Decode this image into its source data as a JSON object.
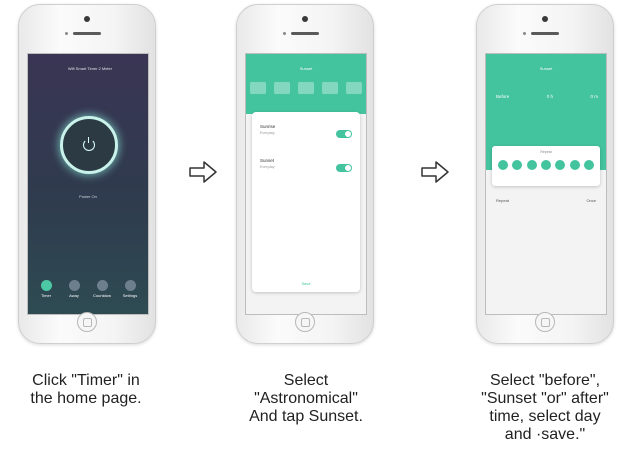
{
  "steps": [
    {
      "caption_lines": [
        "Click \"Timer\" in",
        "the home page."
      ],
      "screen": {
        "title": "Wifi Smart Timer 2 Meter",
        "status": "Power On",
        "nav": [
          "Timer",
          "Away",
          "Countdown",
          "Settings"
        ]
      }
    },
    {
      "caption_lines": [
        "Select",
        "\"Astronomical\"",
        "And tap Sunset."
      ],
      "screen": {
        "title": "Sunset",
        "rows": [
          {
            "label": "Sunrise",
            "sub": "Everyday"
          },
          {
            "label": "Sunset",
            "sub": "Everyday"
          }
        ],
        "save": "Save"
      }
    },
    {
      "caption_lines": [
        "Select \"before\",",
        "\"Sunset \"or\" after\"",
        "time, select day",
        "and ·save.\""
      ],
      "screen": {
        "title": "Sunset",
        "options": [
          "Before",
          "0 h",
          "0 m"
        ],
        "picker_caption": "Repeat",
        "repeat_label": "Repeat",
        "repeat_value": "Once"
      }
    }
  ],
  "colors": {
    "accent": "#43c39e",
    "dark_bg": "#2f3b4e"
  }
}
